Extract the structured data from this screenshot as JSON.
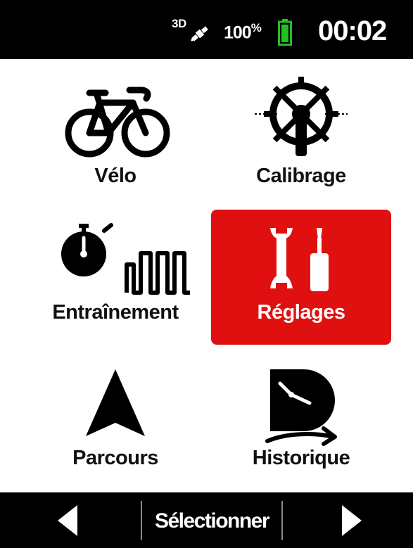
{
  "status_bar": {
    "gps_label": "3D",
    "battery_percent": "100",
    "battery_unit": "%",
    "time": "00:02",
    "battery_color": "#22c020",
    "icons": [
      "satellite-icon",
      "battery-icon"
    ]
  },
  "menu": {
    "selected": "Réglages",
    "accent_color": "#e01010",
    "items": [
      {
        "label": "Vélo",
        "icon": "bicycle-icon"
      },
      {
        "label": "Calibrage",
        "icon": "chainring-icon"
      },
      {
        "label": "Entraînement",
        "icon": "stopwatch-interval-icon"
      },
      {
        "label": "Réglages",
        "icon": "wrench-tools-icon"
      },
      {
        "label": "Parcours",
        "icon": "navigation-arrow-icon"
      },
      {
        "label": "Historique",
        "icon": "history-clock-icon"
      }
    ]
  },
  "bottom_bar": {
    "select_label": "Sélectionner",
    "icons": [
      "arrow-left-icon",
      "arrow-right-icon"
    ]
  }
}
